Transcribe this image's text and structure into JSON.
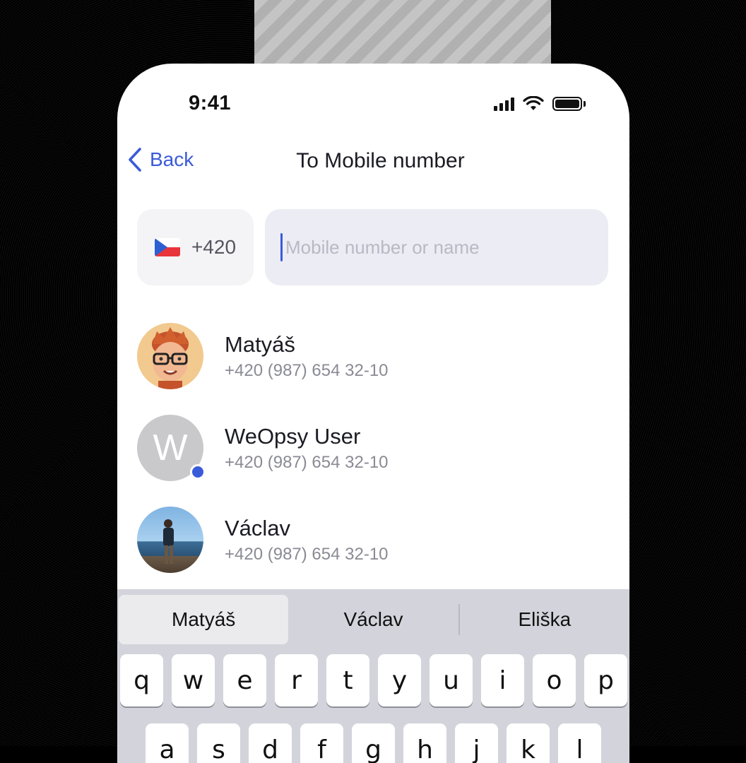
{
  "status_bar": {
    "time": "9:41",
    "signal_icon": "signal-bars-icon",
    "wifi_icon": "wifi-icon",
    "battery_icon": "battery-icon"
  },
  "nav": {
    "back_label": "Back",
    "back_icon": "chevron-left-icon",
    "title": "To Mobile number"
  },
  "phone_input": {
    "country_flag": "czech-flag-icon",
    "dial_code": "+420",
    "value": "",
    "placeholder": "Mobile number or name"
  },
  "contacts": [
    {
      "name": "Matyáš",
      "phone": "+420 (987) 654 32-10",
      "avatar": "memoji-avatar"
    },
    {
      "name": "WeOpsy User",
      "phone": "+420 (987) 654 32-10",
      "avatar_letter": "W",
      "online": true
    },
    {
      "name": "Václav",
      "phone": "+420 (987) 654 32-10",
      "avatar": "photo-avatar"
    }
  ],
  "keyboard": {
    "suggestions": [
      "Matyáš",
      "Václav",
      "Eliška"
    ],
    "row1": [
      "q",
      "w",
      "e",
      "r",
      "t",
      "y",
      "u",
      "i",
      "o",
      "p"
    ],
    "row2": [
      "a",
      "s",
      "d",
      "f",
      "g",
      "h",
      "j",
      "k",
      "l"
    ]
  },
  "colors": {
    "accent": "#3a5bd9",
    "input_bg": "#ececf4",
    "keyboard_bg": "#d3d4db"
  }
}
